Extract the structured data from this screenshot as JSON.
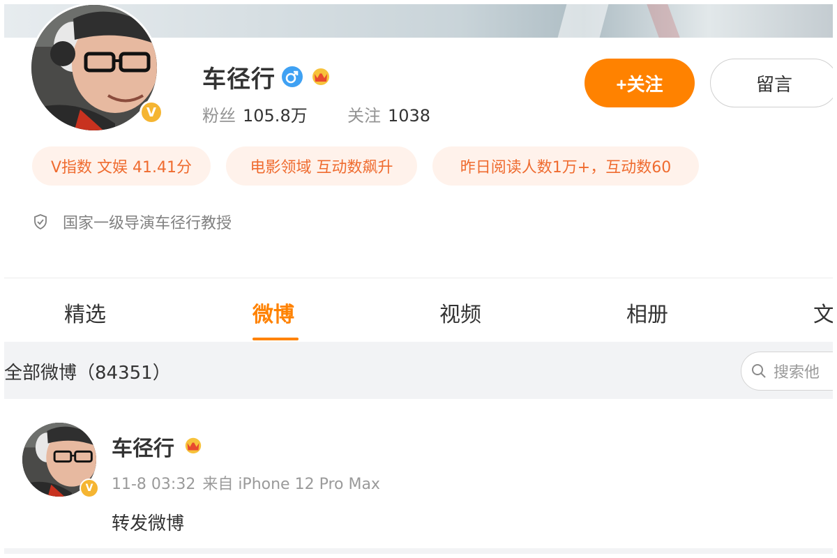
{
  "profile": {
    "name": "车径行",
    "avatar_badge": "V",
    "stats": {
      "fans_label": "粉丝",
      "fans_value": "105.8万",
      "following_label": "关注",
      "following_value": "1038"
    },
    "follow_button": "+关注",
    "message_button": "留言",
    "tags": [
      "V指数 文娱 41.41分",
      "电影领域 互动数飙升",
      "昨日阅读人数1万+，互动数60"
    ],
    "verification": "国家一级导演车径行教授"
  },
  "tabs": [
    {
      "label": "精选",
      "active": false
    },
    {
      "label": "微博",
      "active": true
    },
    {
      "label": "视频",
      "active": false
    },
    {
      "label": "相册",
      "active": false
    },
    {
      "label": "文",
      "active": false
    }
  ],
  "filter": {
    "label": "全部微博（84351）",
    "search_placeholder": "搜索他"
  },
  "post": {
    "author": "车径行",
    "time": "11-8 03:32",
    "source": "来自 iPhone 12 Pro Max",
    "content": "转发微博"
  },
  "colors": {
    "accent": "#ff8200",
    "tag_text": "#ef6b2f",
    "tag_bg": "#fff2eb",
    "verified_badge": "#f5b532",
    "male_icon": "#3fa1f3"
  },
  "icons": [
    "male-icon",
    "crown-icon",
    "shield-icon",
    "search-icon",
    "verified-v-icon"
  ]
}
